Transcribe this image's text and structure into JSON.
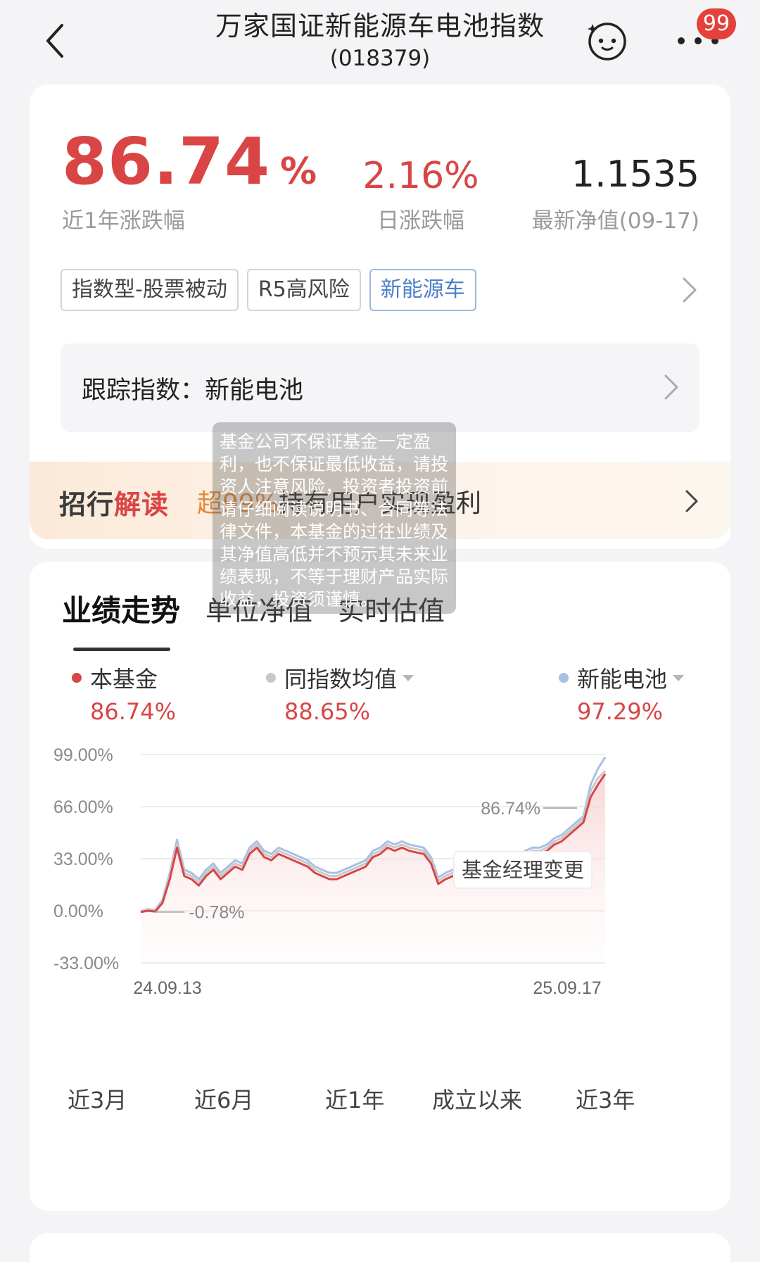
{
  "header": {
    "title": "万家国证新能源车电池指数",
    "subtitle": "(018379)",
    "badge": "99"
  },
  "summary": {
    "return_1y_value": "86.74",
    "return_1y_unit": "%",
    "return_1y_label": "近1年涨跌幅",
    "daily_return": "2.16%",
    "daily_return_label": "日涨跌幅",
    "nav": "1.1535",
    "nav_label": "最新净值(09-17)",
    "tags": [
      "指数型-股票被动",
      "R5高风险",
      "新能源车"
    ],
    "tracking_index": "跟踪指数：新能电池"
  },
  "promo": {
    "brand_a": "招行",
    "brand_b": "解读",
    "highlight": "超99%",
    "text": "持有用户实现盈利"
  },
  "performance": {
    "tabs": [
      "业绩走势",
      "单位净值",
      "实时估值"
    ],
    "legend": [
      {
        "name": "本基金",
        "value": "86.74%",
        "color": "#d94545",
        "caret": false
      },
      {
        "name": "同指数均值",
        "value": "88.65%",
        "color": "#c8c8c8",
        "caret": true
      },
      {
        "name": "新能电池",
        "value": "97.29%",
        "color": "#a8c0e6",
        "caret": true
      }
    ],
    "periods": [
      "近3月",
      "近6月",
      "近1年",
      "成立以来",
      "近3年"
    ],
    "disclaimer": "基金公司不保证基金一定盈利，也不保证最低收益，请投资人注意风险，投资者投资前请仔细阅读说明书、合同等法律文件，本基金的过往业绩及其净值高低并不预示其未来业绩表现，不等于理财产品实际收益，投资须谨慎。"
  },
  "chart_data": {
    "type": "line",
    "ylim": [
      -33,
      99
    ],
    "yticks": [
      "99.00%",
      "66.00%",
      "33.00%",
      "0.00%",
      "-33.00%"
    ],
    "x_start_label": "24.09.13",
    "x_end_label": "25.09.17",
    "min_label": "-0.78%",
    "end_label": "86.74%",
    "annotation": "基金经理变更",
    "colors": {
      "fund": "#d94545",
      "avg": "#c8c8c8",
      "index": "#a8c0e6"
    },
    "series": [
      {
        "name": "本基金",
        "values": [
          -0.78,
          0,
          -0.5,
          5,
          20,
          40,
          22,
          20,
          16,
          22,
          26,
          20,
          24,
          28,
          26,
          36,
          40,
          34,
          32,
          36,
          34,
          32,
          30,
          28,
          24,
          22,
          20,
          20,
          22,
          24,
          26,
          28,
          34,
          36,
          40,
          38,
          40,
          38,
          37,
          36,
          30,
          17,
          20,
          22,
          24,
          26,
          30,
          32,
          30,
          28,
          28,
          27,
          30,
          34,
          36,
          36,
          38,
          42,
          44,
          48,
          52,
          56,
          72,
          80,
          86.74
        ]
      },
      {
        "name": "同指数均值",
        "values": [
          -0.5,
          0.5,
          0,
          6,
          22,
          42,
          24,
          22,
          18,
          24,
          28,
          22,
          26,
          30,
          28,
          38,
          42,
          36,
          34,
          38,
          36,
          34,
          32,
          30,
          26,
          24,
          22,
          22,
          24,
          26,
          28,
          30,
          36,
          38,
          42,
          40,
          42,
          40,
          39,
          38,
          32,
          19,
          22,
          24,
          26,
          28,
          32,
          34,
          32,
          30,
          30,
          29,
          32,
          36,
          38,
          38,
          40,
          44,
          46,
          50,
          54,
          58,
          76,
          84,
          88.65
        ]
      },
      {
        "name": "新能电池",
        "values": [
          -0.2,
          1,
          0.5,
          7,
          24,
          45,
          26,
          24,
          20,
          26,
          30,
          24,
          28,
          32,
          30,
          40,
          44,
          38,
          36,
          40,
          38,
          36,
          34,
          32,
          28,
          26,
          24,
          24,
          26,
          28,
          30,
          32,
          38,
          40,
          44,
          42,
          44,
          42,
          41,
          40,
          34,
          21,
          24,
          26,
          28,
          30,
          34,
          36,
          34,
          32,
          32,
          31,
          34,
          38,
          40,
          40,
          42,
          46,
          48,
          52,
          56,
          60,
          80,
          90,
          97.29
        ]
      }
    ],
    "manager_change_index": 52,
    "grid": true
  }
}
